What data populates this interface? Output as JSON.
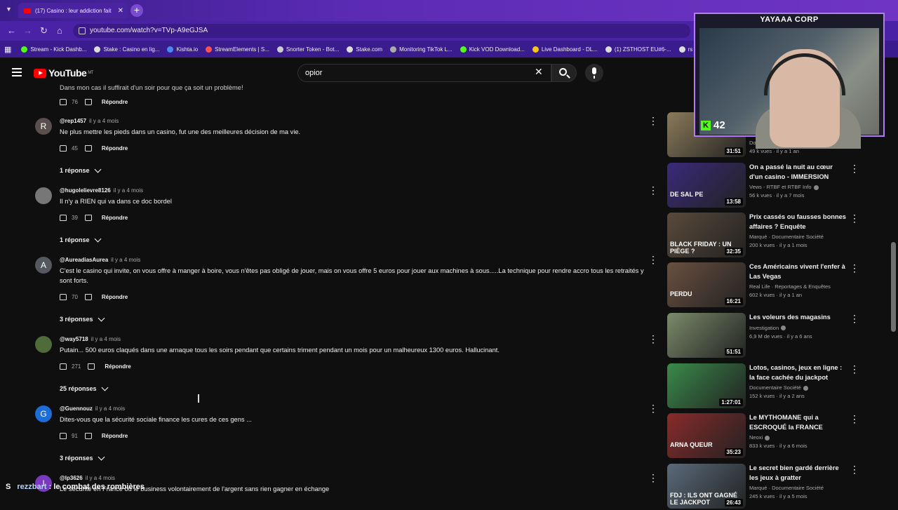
{
  "browser": {
    "tab_title": "(17) Casino : leur addiction fait",
    "url": "youtube.com/watch?v=TVp-A9eGJSA",
    "bookmarks": [
      "Stream - Kick Dashb...",
      "Stake : Casino en lig...",
      "Kishta.io",
      "StreamElements | S...",
      "Snorter Token - Bot...",
      "Stake.com",
      "Monitoring TikTok L...",
      "Kick VOD Download...",
      "Live Dashboard - DL...",
      "(1) ZSTHOST EU#6-...",
      "rs"
    ]
  },
  "youtube": {
    "logo_text": "YouTube",
    "logo_region": "MT",
    "search_value": "opior"
  },
  "comments": [
    {
      "partial_text": "Dans mon cas il suffirait d'un soir pour que ça soit un problème!",
      "likes": "76",
      "reply_label": "Répondre"
    },
    {
      "avatar_letter": "R",
      "avatar_color": "#5a4f4f",
      "handle": "@rep1457",
      "time": "il y a 4 mois",
      "text": "Ne plus mettre les pieds dans un casino, fut une des meilleures décision de ma vie.",
      "likes": "45",
      "reply_label": "Répondre",
      "replies": "1 réponse"
    },
    {
      "avatar_letter": "",
      "avatar_color": "#777777",
      "handle": "@hugolelievre8126",
      "time": "il y a 4 mois",
      "text": "Il n'y a RIEN qui va dans ce doc bordel",
      "likes": "39",
      "reply_label": "Répondre",
      "replies": "1 réponse"
    },
    {
      "avatar_letter": "A",
      "avatar_color": "#55585e",
      "handle": "@AureadiasAurea",
      "time": "il y a 4 mois",
      "text": "C'est le casino qui invite, on vous offre à manger à boire, vous n'êtes pas obligé de jouer, mais on vous offre 5 euros pour jouer aux machines à sous.....La technique pour rendre accro tous les retraités y sont forts.",
      "likes": "70",
      "reply_label": "Répondre",
      "replies": "3 réponses"
    },
    {
      "avatar_letter": "",
      "avatar_color": "#4f6b3a",
      "handle": "@way5718",
      "time": "il y a 4 mois",
      "text": "Putain... 500 euros claqués dans une arnaque tous les soirs pendant que certains triment pendant un mois pour un malheureux 1300 euros. Hallucinant.",
      "likes": "271",
      "reply_label": "Répondre",
      "replies": "25 réponses"
    },
    {
      "avatar_letter": "G",
      "avatar_color": "#1e6cd6",
      "handle": "@Guennouz",
      "time": "il y a 4 mois",
      "text": "Dites-vous que la sécurité sociale finance les cures de ces gens ...",
      "likes": "91",
      "reply_label": "Répondre",
      "replies": "3 réponses"
    },
    {
      "avatar_letter": "I",
      "avatar_color": "#7a3ac0",
      "handle": "@lp3626",
      "time": "il y a 4 mois",
      "text": "Le sécurité en France ou le business volontairement de l'argent sans rien gagner en échange"
    }
  ],
  "sidebar": [
    {
      "title": "",
      "channel": "Documentaire Société",
      "meta": "49 k vues · il y a 1 an",
      "duration": "31:51",
      "thumb_color": "#8a7a5a",
      "verified": true
    },
    {
      "title": "On a passé la nuit au cœur d'un casino - IMMERSION",
      "channel": "Vews - RTBF et RTBF Info",
      "meta": "56 k vues · il y a 7 mois",
      "duration": "13:58",
      "thumb_color": "#3a2a7a",
      "thumb_text": "DE SAL PE",
      "verified": true
    },
    {
      "title": "Prix cassés ou fausses bonnes affaires ? Enquête",
      "channel": "Marqué · Documentaire Société",
      "meta": "200 k vues · il y a 1 mois",
      "duration": "32:35",
      "thumb_color": "#5a4a3a",
      "thumb_text": "BLACK FRIDAY : UN PIÈGE ?",
      "verified": false
    },
    {
      "title": "Ces Américains vivent l'enfer à Las Vegas",
      "channel": "Real Life · Reportages & Enquêtes",
      "meta": "602 k vues · il y a 1 an",
      "duration": "16:21",
      "thumb_color": "#6a5040",
      "thumb_text": "PERDU",
      "verified": false
    },
    {
      "title": "Les voleurs des magasins",
      "channel": "Investigation",
      "meta": "6,9 M de vues · il y a 6 ans",
      "duration": "51:51",
      "thumb_color": "#7a8a6a",
      "verified": true
    },
    {
      "title": "Lotos, casinos, jeux en ligne : la face cachée du jackpot",
      "channel": "Documentaire Société",
      "meta": "152 k vues · il y a 2 ans",
      "duration": "1:27:01",
      "thumb_color": "#3a8a4a",
      "verified": true
    },
    {
      "title": "Le MYTHOMANE qui a ESCROQUÉ la FRANCE (Marco...",
      "channel": "Neoxi",
      "meta": "833 k vues · il y a 6 mois",
      "duration": "35:23",
      "thumb_color": "#8a2a2a",
      "thumb_text": "ARNA QUEUR",
      "verified": true
    },
    {
      "title": "Le secret bien gardé derrière les jeux à gratter",
      "channel": "Marqué · Documentaire Société",
      "meta": "245 k vues · il y a 5 mois",
      "duration": "26:43",
      "thumb_color": "#5a6a7a",
      "thumb_text": "FDJ : ILS ONT GAGNÉ LE JACKPOT",
      "verified": false
    }
  ],
  "webcam": {
    "title": "YAYAAA CORP",
    "kick_logo": "K",
    "viewers": "42",
    "border_color": "#b37cf0"
  },
  "chat": {
    "icon": "S",
    "user": "rezzbart",
    "message": ": le combat des rombières"
  }
}
